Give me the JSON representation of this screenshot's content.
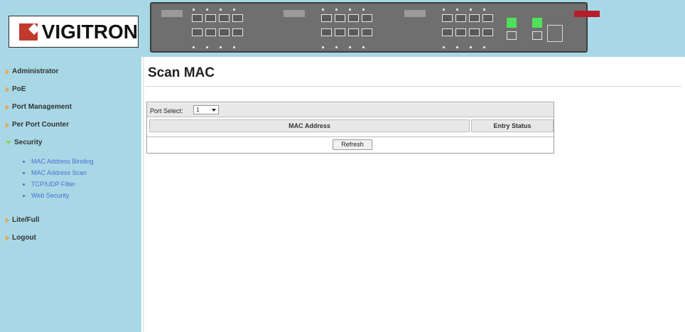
{
  "header": {
    "logo_text": "VIGITRON"
  },
  "sidebar": {
    "items": [
      {
        "label": "Administrator"
      },
      {
        "label": "PoE"
      },
      {
        "label": "Port Management"
      },
      {
        "label": "Per Port Counter"
      },
      {
        "label": "Security",
        "expanded": true
      },
      {
        "label": "Lite/Full"
      },
      {
        "label": "Logout"
      }
    ],
    "security_sub": [
      {
        "label": "MAC Address Binding"
      },
      {
        "label": "MAC Address Scan"
      },
      {
        "label": "TCP/UDP Filter"
      },
      {
        "label": "Web Security"
      }
    ]
  },
  "main": {
    "title": "Scan MAC",
    "port_select_label": "Port Select:",
    "port_select_value": "1",
    "columns": [
      "MAC Address",
      "Entry Status"
    ],
    "refresh_label": "Refresh"
  },
  "colors": {
    "sidebar_bg": "#a8d8e6",
    "link": "#4a6fd1",
    "logo_red": "#c0392b"
  }
}
